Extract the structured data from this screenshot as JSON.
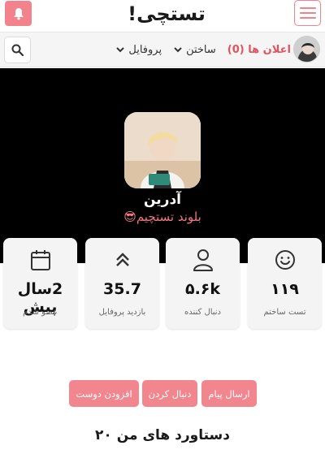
{
  "header": {
    "logo_text": "تستچی!",
    "bell_icon": "bell-icon",
    "menu_icon": "hamburger-menu-icon",
    "accent_color": "#f2828c"
  },
  "nav": {
    "search_icon": "search-icon",
    "items": [
      {
        "label": "پروفایل",
        "icon": "chevron-down-icon"
      },
      {
        "label": "ساختن",
        "icon": "chevron-down-icon"
      },
      {
        "label": "اعلان ها (0)"
      }
    ]
  },
  "profile": {
    "name": "آدرین",
    "bio": "بلوند تستچیم😎",
    "banner_color": "#000000"
  },
  "stats": [
    {
      "icon": "smiley-icon",
      "value": "۱۱۹",
      "label": "تست ساختم"
    },
    {
      "icon": "user-icon",
      "value": "۵.۶k",
      "label": "دنبال کننده"
    },
    {
      "icon": "double-chevron-up-icon",
      "value": "35.7",
      "label": "بازدید پروفایل"
    },
    {
      "icon": "calendar-icon",
      "value": "2سال پیش",
      "label": "عضو شدم"
    }
  ],
  "actions": {
    "send_message": "ارسال پیام",
    "follow": "دنبال کردن",
    "add_friend": "افزودن دوست"
  },
  "achievements": {
    "title": "دستاورد های من ۲۰"
  }
}
